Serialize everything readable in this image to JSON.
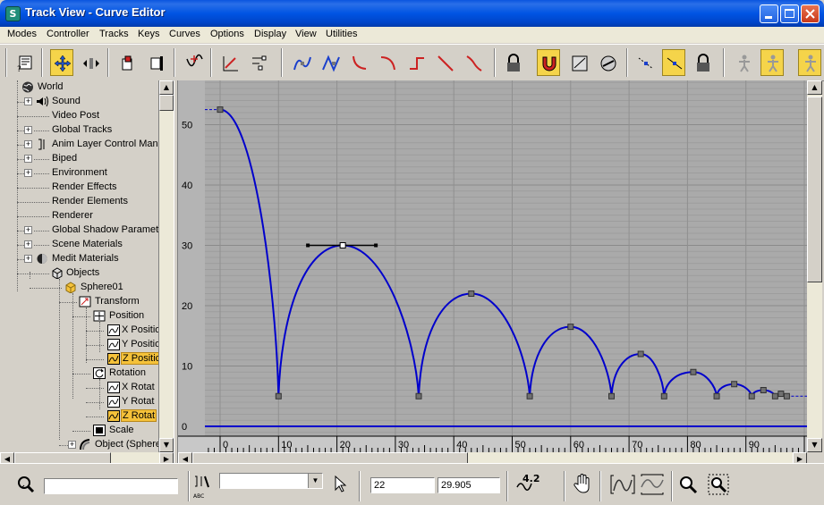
{
  "window": {
    "title": "Track View - Curve Editor",
    "app_icon": "3ds-max-icon",
    "title_bar_color": "#0054e3"
  },
  "menu": [
    "Modes",
    "Controller",
    "Tracks",
    "Keys",
    "Curves",
    "Options",
    "Display",
    "View",
    "Utilities"
  ],
  "toolbar": {
    "icons": [
      "filter-icon",
      "move-keys-icon",
      "slide-keys-icon",
      "scale-keys-icon",
      "scale-values-icon",
      "insert-keys-icon",
      "draw-curves-icon",
      "reduce-keys-icon",
      "parameter-curve-out-of-range-icon",
      "parameter-curve-ease-icon",
      "tangent-auto-icon",
      "tangent-custom-icon",
      "tangent-fast-icon",
      "tangent-slow-icon",
      "tangent-step-icon",
      "tangent-linear-icon",
      "tangent-smooth-icon",
      "lock-selection-icon",
      "snap-frames-icon",
      "show-keyable-icon",
      "show-all-tangents-icon",
      "show-tangents-icon",
      "lock-tangents-icon",
      "show-biped-positions-icon",
      "show-biped-rotations-icon",
      "show-biped-xyz-icon"
    ],
    "active": [
      "move-keys-icon",
      "snap-frames-icon",
      "show-tangents-icon",
      "show-biped-rotations-icon",
      "show-biped-xyz-icon"
    ],
    "accent_color": "#f5d44a"
  },
  "tree": {
    "items": [
      {
        "label": "World",
        "icon": "globe-icon"
      },
      {
        "label": "Sound",
        "icon": "sound-icon"
      },
      {
        "label": "Video Post"
      },
      {
        "label": "Global Tracks"
      },
      {
        "label": "Anim Layer Control Mana",
        "icon": "bracket-icon"
      },
      {
        "label": "Biped"
      },
      {
        "label": "Environment"
      },
      {
        "label": "Render Effects"
      },
      {
        "label": "Render Elements"
      },
      {
        "label": "Renderer"
      },
      {
        "label": "Global Shadow Paramete"
      },
      {
        "label": "Scene Materials"
      },
      {
        "label": "Medit Materials",
        "icon": "material-sphere-icon"
      },
      {
        "label": "Objects",
        "icon": "objects-icon"
      },
      {
        "label": "Sphere01",
        "icon": "object-box-icon"
      },
      {
        "label": "Transform",
        "icon": "transform-icon"
      },
      {
        "label": "Position",
        "icon": "position-icon"
      },
      {
        "label": "X Positio",
        "icon": "curve-track-icon"
      },
      {
        "label": "Y Positio",
        "icon": "curve-track-icon"
      },
      {
        "label": "Z Positio",
        "icon": "curve-track-icon",
        "selected": true
      },
      {
        "label": "Rotation",
        "icon": "rotation-icon"
      },
      {
        "label": "X Rotat",
        "icon": "curve-track-icon"
      },
      {
        "label": "Y Rotat",
        "icon": "curve-track-icon"
      },
      {
        "label": "Z Rotat",
        "icon": "curve-track-icon",
        "selected": true
      },
      {
        "label": "Scale",
        "icon": "scale-icon"
      },
      {
        "label": "Object (Sphere",
        "icon": "object-sphere-icon"
      }
    ]
  },
  "graph": {
    "y_ticks": [
      "0",
      "10",
      "20",
      "30",
      "40",
      "50"
    ],
    "x_ticks": [
      "0",
      "10",
      "20",
      "30",
      "40",
      "50",
      "60",
      "70",
      "80",
      "90"
    ],
    "background": "#aaaaaa",
    "curve_color": "#0000cc",
    "curve_keys": [
      {
        "frame": 0,
        "value": 52.5
      },
      {
        "frame": 10,
        "value": 5
      },
      {
        "frame": 21,
        "value": 30,
        "selected": true
      },
      {
        "frame": 34,
        "value": 5
      },
      {
        "frame": 43,
        "value": 22
      },
      {
        "frame": 53,
        "value": 5
      },
      {
        "frame": 60,
        "value": 16.5
      },
      {
        "frame": 67,
        "value": 5
      },
      {
        "frame": 72,
        "value": 12
      },
      {
        "frame": 76,
        "value": 5
      },
      {
        "frame": 81,
        "value": 9
      },
      {
        "frame": 85,
        "value": 5
      },
      {
        "frame": 88,
        "value": 7
      },
      {
        "frame": 91,
        "value": 5
      },
      {
        "frame": 93,
        "value": 6
      },
      {
        "frame": 95,
        "value": 5
      },
      {
        "frame": 96,
        "value": 5.4
      },
      {
        "frame": 97,
        "value": 5
      }
    ]
  },
  "status": {
    "frame_value": "22",
    "key_value": "29.905",
    "misc_icon_label": "4.2",
    "abc_label": "ABC"
  }
}
